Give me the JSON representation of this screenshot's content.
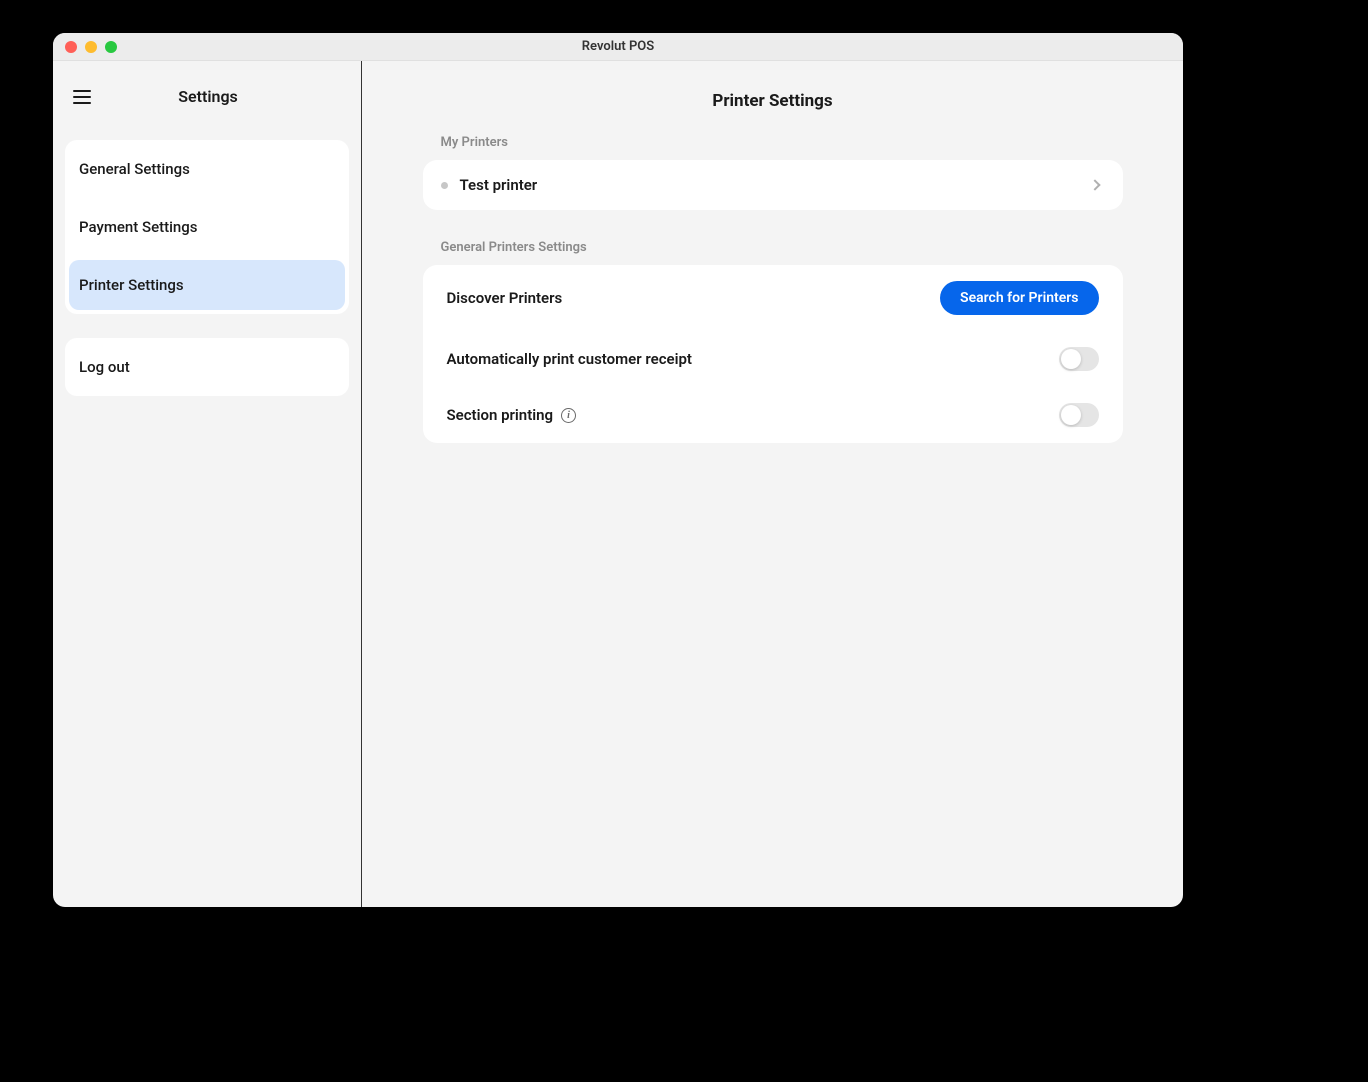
{
  "window": {
    "title": "Revolut POS"
  },
  "sidebar": {
    "title": "Settings",
    "items": [
      {
        "label": "General Settings",
        "selected": false
      },
      {
        "label": "Payment Settings",
        "selected": false
      },
      {
        "label": "Printer Settings",
        "selected": true
      }
    ],
    "logout_label": "Log out"
  },
  "main": {
    "title": "Printer Settings",
    "my_printers_label": "My Printers",
    "printers": [
      {
        "name": "Test printer",
        "status": "offline"
      }
    ],
    "general_settings_label": "General Printers Settings",
    "settings": {
      "discover_label": "Discover Printers",
      "search_button_label": "Search for Printers",
      "auto_print_label": "Automatically print customer receipt",
      "auto_print_enabled": false,
      "section_printing_label": "Section printing",
      "section_printing_enabled": false
    }
  }
}
